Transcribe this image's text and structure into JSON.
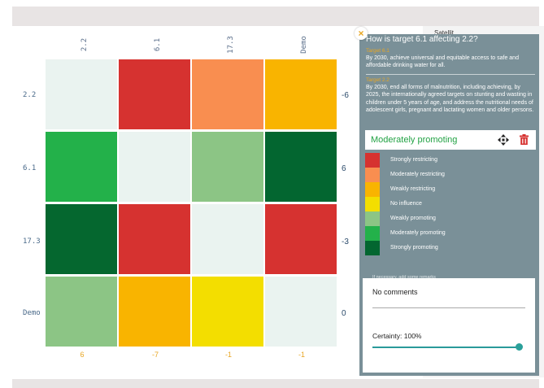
{
  "labels": [
    "2.2",
    "6.1",
    "17.3",
    "Demo"
  ],
  "matrix": [
    [
      "#eaf3f0",
      "#d63230",
      "#f98e50",
      "#f9b400"
    ],
    [
      "#23b14a",
      "#eaf3f0",
      "#8cc585",
      "#036630"
    ],
    [
      "#05672f",
      "#d63230",
      "#eaf3f0",
      "#d63230"
    ],
    [
      "#8cc585",
      "#f9b400",
      "#f3de00",
      "#eaf3f0"
    ]
  ],
  "row_sums": [
    "-6",
    "6",
    "-3",
    "0"
  ],
  "col_sums": [
    "6",
    "-7",
    "-1",
    "-1"
  ],
  "background_sidebar_item": "Satellit",
  "panel": {
    "close": "×",
    "title": "How is target 6.1 affecting 2.2?",
    "target1_label": "Target 6.1",
    "target1_text": "By 2030, achieve universal and equitable access to safe and affordable drinking water for all.",
    "target2_label": "Target 2.2",
    "target2_text": "By 2030, end all forms of malnutrition, including achieving, by 2025, the internationally agreed targets on stunting and wasting in children under 5 years of age, and address the nutritional needs of adolescent girls, pregnant and lactating women and older persons.",
    "selected": "Moderately promoting",
    "move_icon": "move-icon",
    "delete_icon": "trash-icon",
    "legend": [
      {
        "label": "Strongly restricting",
        "color": "#d63230"
      },
      {
        "label": "Moderately restricting",
        "color": "#f98e50"
      },
      {
        "label": "Weakly restricting",
        "color": "#f9b400"
      },
      {
        "label": "No influence",
        "color": "#f3de00"
      },
      {
        "label": "Weakly promoting",
        "color": "#8cc585"
      },
      {
        "label": "Moderately promoting",
        "color": "#23b14a"
      },
      {
        "label": "Strongly promoting",
        "color": "#036630"
      }
    ],
    "remarks_hint": "If necessary, add some remarks",
    "remarks_value": "No comments",
    "certainty_label": "Certainty: 100%",
    "certainty_value": 1.0
  }
}
